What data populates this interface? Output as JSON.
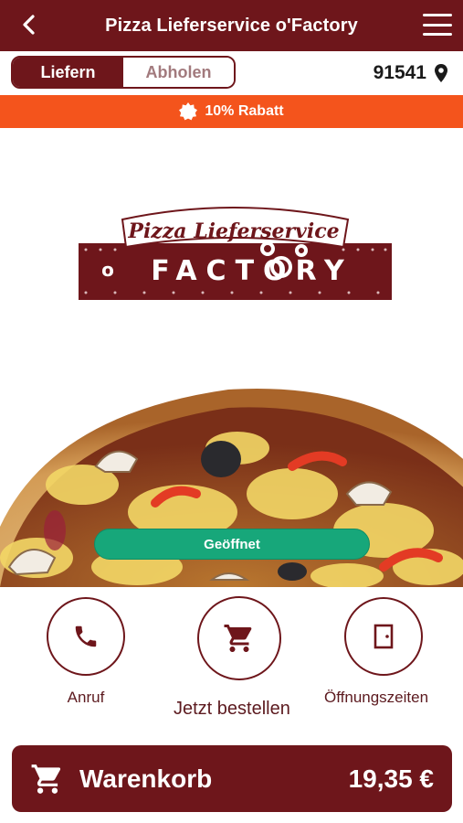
{
  "header": {
    "title": "Pizza Lieferservice o'Factory",
    "back_icon": "chevron-left-icon",
    "menu_icon": "hamburger-menu-icon"
  },
  "mode": {
    "options": [
      "Liefern",
      "Abholen"
    ],
    "selected": "Liefern",
    "zip": "91541",
    "location_icon": "map-pin-icon"
  },
  "promo": {
    "text": "10% Rabatt",
    "icon": "badge-icon",
    "color": "#f4541c"
  },
  "logo": {
    "line1": "Pizza Lieferservice",
    "line2": "FACTORY",
    "prefix": "o"
  },
  "status": {
    "label": "Geöffnet",
    "color": "#17a77a"
  },
  "actions": [
    {
      "label": "Anruf",
      "icon": "phone-icon"
    },
    {
      "label": "Jetzt bestellen",
      "icon": "cart-icon"
    },
    {
      "label": "Öffnungszeiten",
      "icon": "door-icon"
    }
  ],
  "cart": {
    "label": "Warenkorb",
    "total": "19,35 €",
    "icon": "cart-icon"
  },
  "colors": {
    "primary": "#6e161b",
    "white": "#ffffff"
  }
}
